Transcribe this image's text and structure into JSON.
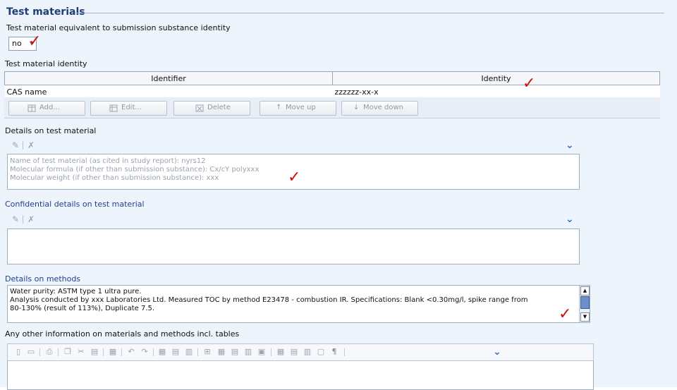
{
  "section_title": "Test materials",
  "equivalent": {
    "label": "Test material equivalent to submission substance identity",
    "selected": "no"
  },
  "identity_table": {
    "title": "Test material identity",
    "columns": [
      "Identifier",
      "Identity"
    ],
    "rows": [
      {
        "identifier": "CAS name",
        "identity": "zzzzzz-xx-x"
      }
    ],
    "buttons": {
      "add": "Add...",
      "edit": "Edit...",
      "delete": "Delete",
      "move_up": "Move up",
      "move_down": "Move down"
    }
  },
  "details_on_test_material": {
    "label": "Details on test material",
    "lines": [
      "Name of test material (as cited in study report): nyrs12",
      "Molecular formula (if other than submission substance): Cx/cY polyxxx",
      "Molecular weight (if other than submission substance): xxx"
    ]
  },
  "confidential_details": {
    "label": "Confidential details on test material"
  },
  "details_on_methods": {
    "label": "Details on methods",
    "lines": [
      "Water purity: ASTM type 1 ultra pure.",
      "Analysis conducted by xxx Laboratories Ltd.  Measured TOC by method E23478 - combustion IR.  Specifications: Blank <0.30mg/l, spike range from",
      "80-130% (result of 113%), Duplicate 7.5."
    ]
  },
  "other_information": {
    "label": "Any other information on materials and methods incl. tables"
  },
  "icons": {
    "checkmark": "✓",
    "expand": "double-chevron-down-icon",
    "paragraph": "¶"
  },
  "colors": {
    "check_red": "#cc1111",
    "link_blue": "#1d3f93",
    "chevron_blue": "#2e6fd0"
  }
}
